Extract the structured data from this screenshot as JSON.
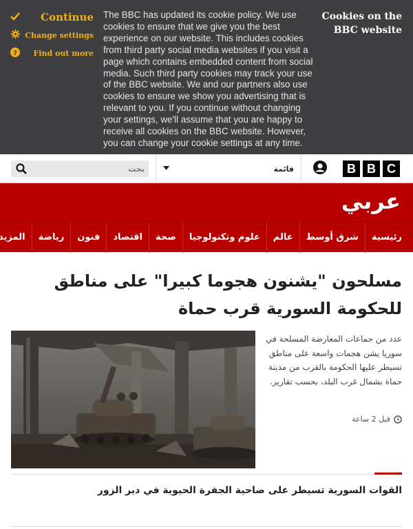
{
  "cookie_banner": {
    "continue_label": "Continue",
    "change_settings_label": "Change settings",
    "find_out_more_label": "Find out more",
    "body_text": "The BBC has updated its cookie policy. We use cookies to ensure that we give you the best experience on our website. This includes cookies from third party social media websites if you visit a page which contains embedded content from social media. Such third party cookies may track your use of the BBC website. We and our partners also use cookies to ensure we show you advertising that is relevant to you. If you continue without changing your settings, we'll assume that you are happy to receive all cookies on the BBC website. However, you can change your cookie settings at any time.",
    "title": "Cookies on the BBC website"
  },
  "header": {
    "search_placeholder": "بحث",
    "menu_label": "قائمة",
    "logo_letters": [
      "B",
      "B",
      "C"
    ]
  },
  "masthead": {
    "brand": "عربي"
  },
  "nav": {
    "items": [
      "رئيسية",
      "شرق أوسط",
      "عالم",
      "علوم وتكنولوجيا",
      "صحة",
      "اقتصاد",
      "فنون",
      "رياضة"
    ],
    "more_label": "المزيد"
  },
  "article": {
    "headline": "مسلحون \"يشنون هجوما كبيرا\" على مناطق للحكومة السورية قرب حماة",
    "summary": "عدد من جماعات المعارضة المسلحة في سوريا يشن هجمات واسعة على مناطق تسيطر عليها الحكومة بالقرب من مدينة حماة بشمال غرب البلد، بحسب تقارير.",
    "timestamp": "قبل 2 ساعة"
  },
  "secondary_story": {
    "headline": "القوات السورية تسيطر على ضاحية الجفرة الحيوية في دير الزور"
  },
  "colors": {
    "bbc_red": "#b80000",
    "banner_bg": "#3f3f42",
    "banner_accent": "#f0b016"
  }
}
